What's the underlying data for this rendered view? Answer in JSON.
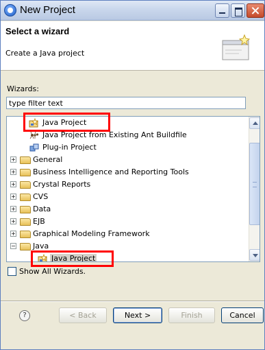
{
  "window": {
    "title": "New Project"
  },
  "header": {
    "title": "Select a wizard",
    "description": "Create a Java project"
  },
  "wizards_label": "Wizards:",
  "filter": {
    "value": "type filter text"
  },
  "tree": {
    "items": [
      {
        "label": "Java Project",
        "icon": "java-project-icon"
      },
      {
        "label": "Java Project from Existing Ant Buildfile",
        "icon": "ant-icon"
      },
      {
        "label": "Plug-in Project",
        "icon": "plugin-icon"
      },
      {
        "label": "General",
        "icon": "folder-icon"
      },
      {
        "label": "Business Intelligence and Reporting Tools",
        "icon": "folder-icon"
      },
      {
        "label": "Crystal Reports",
        "icon": "folder-icon"
      },
      {
        "label": "CVS",
        "icon": "folder-icon"
      },
      {
        "label": "Data",
        "icon": "folder-icon"
      },
      {
        "label": "EJB",
        "icon": "folder-icon"
      },
      {
        "label": "Graphical Modeling Framework",
        "icon": "folder-icon"
      },
      {
        "label": "Java",
        "icon": "folder-open-icon"
      },
      {
        "label": "Java Project",
        "icon": "java-project-icon"
      }
    ]
  },
  "show_all": {
    "label": "Show All Wizards.",
    "checked": false
  },
  "buttons": {
    "help": "?",
    "back": "< Back",
    "next": "Next >",
    "finish": "Finish",
    "cancel": "Cancel"
  },
  "colors": {
    "highlight_box": "#ff0000",
    "title_bar": "#c9d7ec"
  }
}
